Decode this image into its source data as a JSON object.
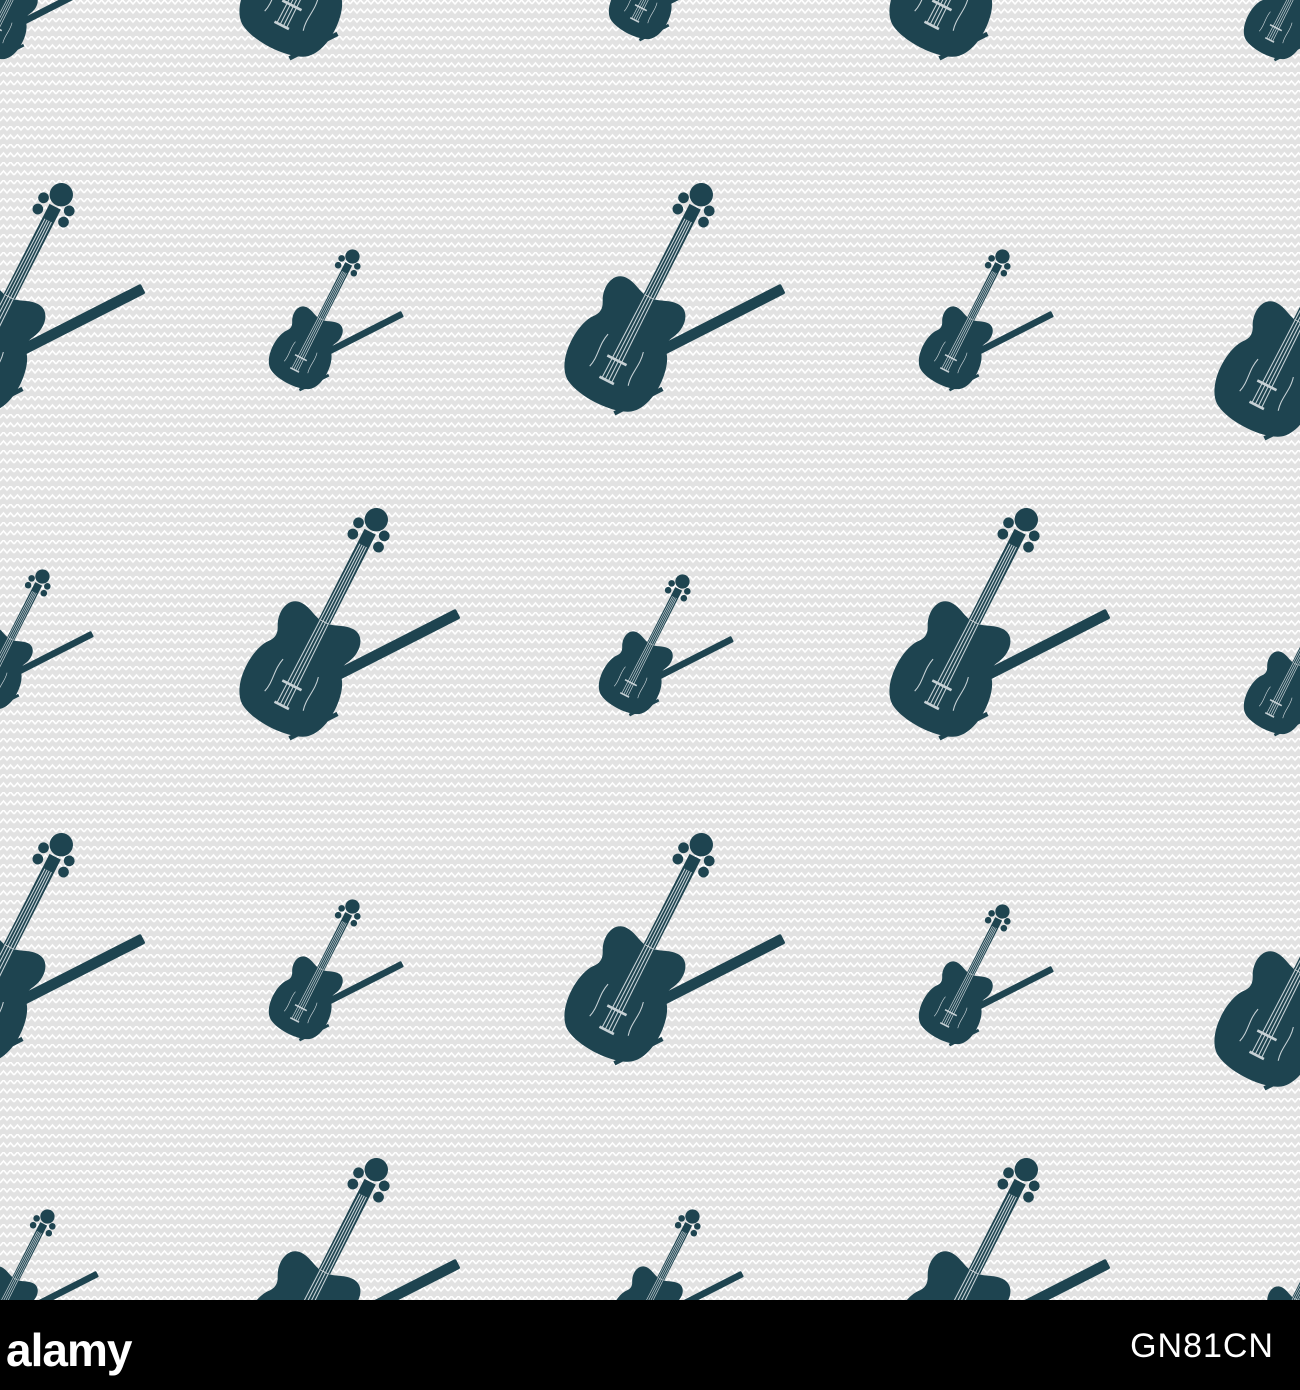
{
  "background_color": "#e2e2e2",
  "zigzag_color": "#ffffff",
  "icon_color": "#1e4450",
  "icon_name": "violin-with-bow-icon",
  "watermark": {
    "brand": "alamy",
    "image_code": "GN81CN",
    "background_color": "#000000",
    "text_color": "#ffffff"
  }
}
